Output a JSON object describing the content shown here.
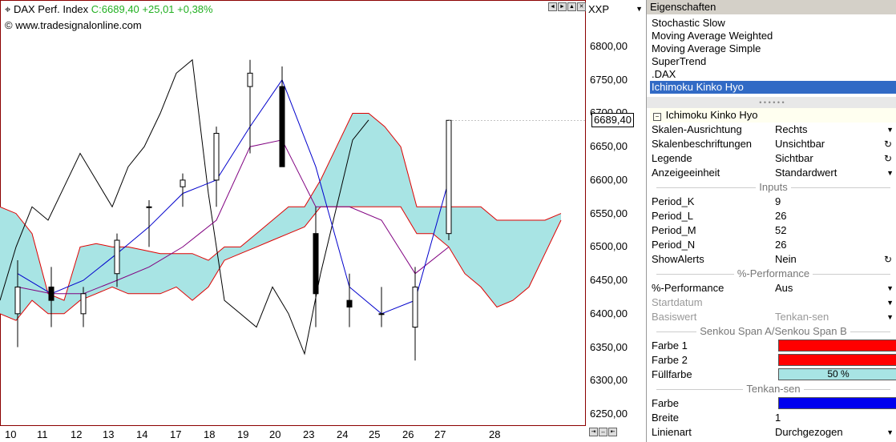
{
  "chart": {
    "symbol_icon": "crosshair-icon",
    "symbol": "DAX Perf. Index",
    "close_info": "C:6689,40 +25,01 +0,38%",
    "copyright": "© www.tradesignalonline.com",
    "controls": [
      "◄",
      "►",
      "▲",
      "✕"
    ],
    "colors": {
      "candle": "#000000",
      "kijun": "#800080",
      "tenkan": "#0000cc",
      "chikou": "#000000",
      "cloud_fill": "#a8e4e4",
      "cloud_edge": "#e00000",
      "frame": "#8b0000"
    }
  },
  "axis": {
    "selector_value": "XXP",
    "y_ticks": [
      "6800,00",
      "6750,00",
      "6700,00",
      "6650,00",
      "6600,00",
      "6550,00",
      "6500,00",
      "6450,00",
      "6400,00",
      "6350,00",
      "6300,00",
      "6250,00"
    ],
    "price_label": "6689,40",
    "x_ticks": [
      "10",
      "11",
      "12",
      "13",
      "14",
      "17",
      "18",
      "19",
      "20",
      "23",
      "24",
      "25",
      "26",
      "27",
      "28"
    ],
    "scroll_icons": [
      "⇥",
      "↔",
      "⇤"
    ]
  },
  "chart_data": {
    "type": "candlestick",
    "x": [
      "10",
      "11",
      "12",
      "13",
      "14",
      "17",
      "18",
      "19",
      "20",
      "23",
      "24",
      "25",
      "26",
      "27"
    ],
    "series": [
      {
        "name": "DAX Perf. Index",
        "open": [
          6400,
          6440,
          6400,
          6460,
          6560,
          6590,
          6600,
          6740,
          6740,
          6520,
          6420,
          6400,
          6380,
          6520
        ],
        "high": [
          6480,
          6470,
          6440,
          6520,
          6570,
          6610,
          6680,
          6780,
          6770,
          6560,
          6460,
          6440,
          6470,
          6690
        ],
        "low": [
          6350,
          6380,
          6380,
          6440,
          6500,
          6560,
          6560,
          6640,
          6620,
          6380,
          6380,
          6380,
          6330,
          6510
        ],
        "close": [
          6440,
          6420,
          6430,
          6510,
          6560,
          6600,
          6670,
          6760,
          6620,
          6430,
          6410,
          6400,
          6440,
          6689.4
        ]
      }
    ],
    "ylim": [
      6230,
      6840
    ]
  },
  "properties": {
    "header": "Eigenschaften",
    "indicators": [
      "Stochastic Slow",
      "Moving Average Weighted",
      "Moving Average Simple",
      "SuperTrend",
      ".DAX",
      "Ichimoku Kinko Hyo"
    ],
    "selected_indicator": "Ichimoku Kinko Hyo",
    "section_title": "Ichimoku Kinko Hyo",
    "rows_general": [
      {
        "key": "Skalen-Ausrichtung",
        "value": "Rechts",
        "control": "▼"
      },
      {
        "key": "Skalenbeschriftungen",
        "value": "Unsichtbar",
        "control": "↻"
      },
      {
        "key": "Legende",
        "value": "Sichtbar",
        "control": "↻"
      },
      {
        "key": "Anzeigeeinheit",
        "value": "Standardwert",
        "control": "▼"
      }
    ],
    "inputs_label": "Inputs",
    "rows_inputs": [
      {
        "key": "Period_K",
        "value": "9"
      },
      {
        "key": "Period_L",
        "value": "26"
      },
      {
        "key": "Period_M",
        "value": "52"
      },
      {
        "key": "Period_N",
        "value": "26"
      },
      {
        "key": "ShowAlerts",
        "value": "Nein",
        "control": "↻"
      }
    ],
    "perf_label": "%-Performance",
    "rows_perf": [
      {
        "key": "%-Performance",
        "value": "Aus",
        "control": "▼"
      },
      {
        "key": "Startdatum",
        "value": "",
        "control": "▼"
      },
      {
        "key": "Basiswert",
        "value": "Tenkan-sen",
        "control": "▼"
      }
    ],
    "senkou_label": "Senkou Span A/Senkou Span B",
    "senkou_rows": [
      {
        "key": "Farbe 1",
        "color": "#ff0000",
        "text": ""
      },
      {
        "key": "Farbe 2",
        "color": "#ff0000",
        "text": ""
      },
      {
        "key": "Füllfarbe",
        "color": "#a8e4e4",
        "text": "50 %"
      }
    ],
    "tenkan_label": "Tenkan-sen",
    "tenkan_rows": [
      {
        "key": "Farbe",
        "color": "#0000ee"
      },
      {
        "key": "Breite",
        "value": "1"
      },
      {
        "key": "Linienart",
        "value": "Durchgezogen",
        "control": "▼"
      }
    ]
  }
}
